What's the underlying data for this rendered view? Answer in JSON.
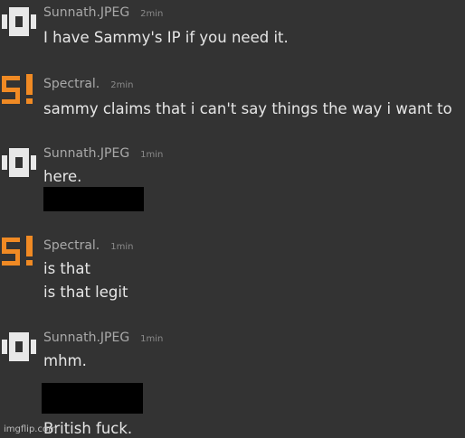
{
  "messages": [
    {
      "author": "Sunnath.JPEG",
      "time": "2min",
      "avatar": "sunnath-avatar-icon",
      "lines": [
        "I have Sammy's IP if you need it."
      ]
    },
    {
      "author": "Spectral.",
      "time": "2min",
      "avatar": "spectral-avatar-icon",
      "lines": [
        "sammy claims that i can't say things the way i want to"
      ]
    },
    {
      "author": "Sunnath.JPEG",
      "time": "1min",
      "avatar": "sunnath-avatar-icon",
      "lines": [
        "here."
      ]
    },
    {
      "author": "Spectral.",
      "time": "1min",
      "avatar": "spectral-avatar-icon",
      "lines": [
        "is that",
        "is that legit"
      ]
    },
    {
      "author": "Sunnath.JPEG",
      "time": "1min",
      "avatar": "sunnath-avatar-icon",
      "lines": [
        "mhm.",
        "British fuck."
      ]
    }
  ],
  "watermark": "imgflip.com",
  "colors": {
    "background": "#333333",
    "spectral_avatar": "#f08a24",
    "sunnath_avatar": "#e8e8e8"
  }
}
